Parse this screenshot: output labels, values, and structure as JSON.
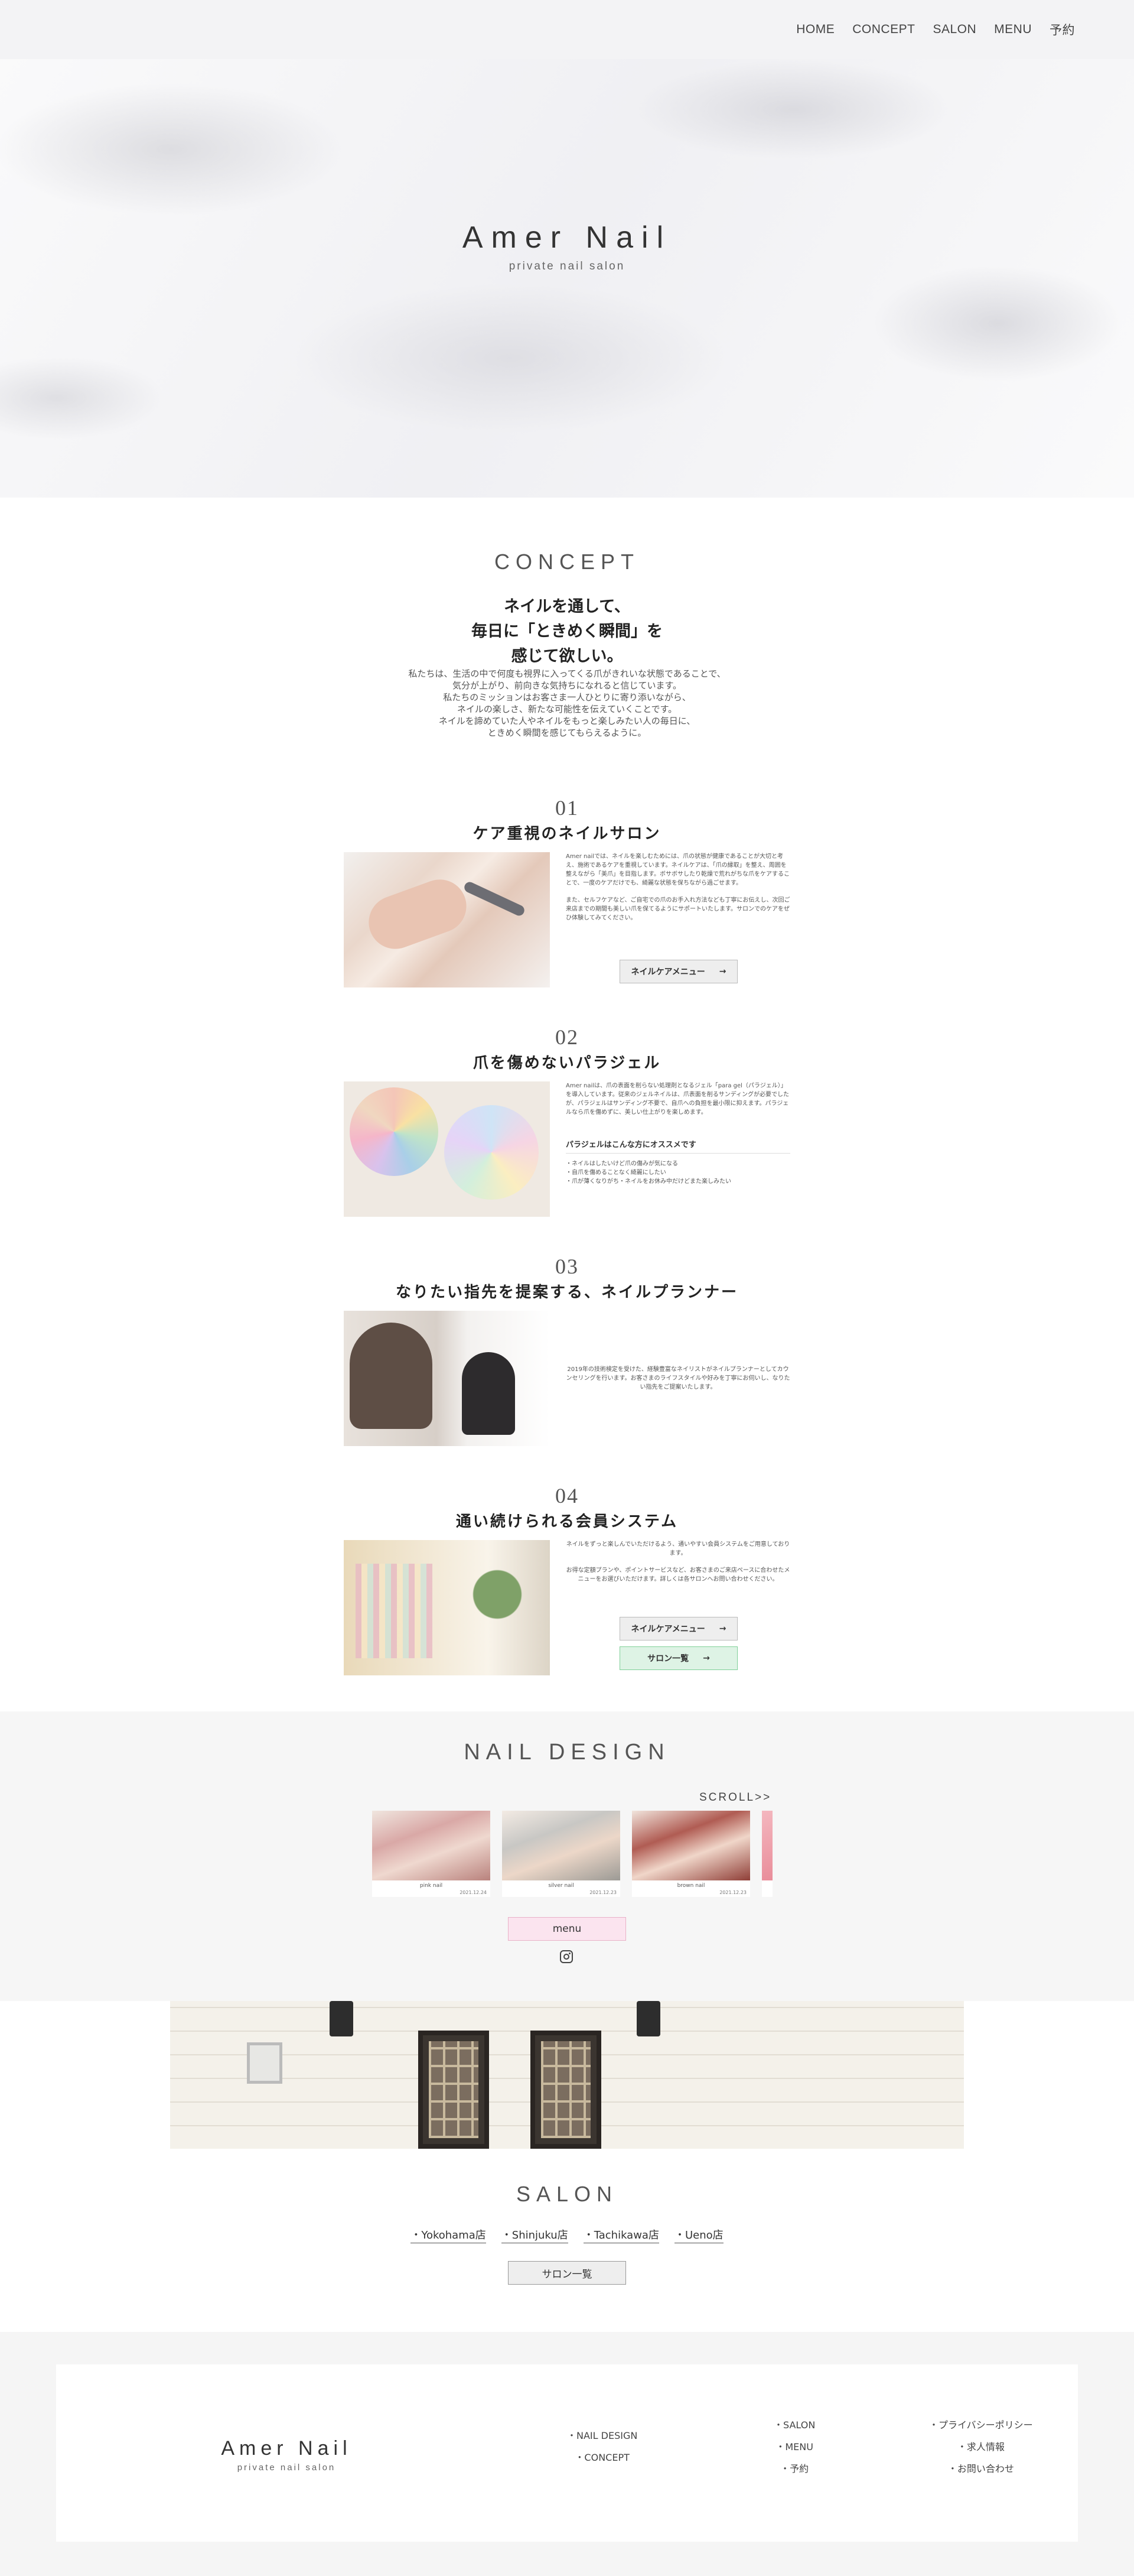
{
  "header": {
    "nav": [
      "HOME",
      "CONCEPT",
      "SALON",
      "MENU",
      "予約"
    ]
  },
  "brand": {
    "name": "Amer Nail",
    "tagline": "private nail salon"
  },
  "concept": {
    "title": "CONCEPT",
    "lead": [
      "ネイルを通して、",
      "毎日に「ときめく瞬間」を",
      "感じて欲しい。"
    ],
    "body": [
      "私たちは、生活の中で何度も視界に入ってくる爪がきれいな状態であることで、",
      "気分が上がり、前向きな気持ちになれると信じています。",
      "私たちのミッションはお客さま一人ひとりに寄り添いながら、",
      "ネイルの楽しさ、新たな可能性を伝えていくことです。",
      "ネイルを諦めていた人やネイルをもっと楽しみたい人の毎日に、",
      "ときめく瞬間を感じてもらえるように。"
    ]
  },
  "features": [
    {
      "num": "01",
      "heading": "ケア重視のネイルサロン",
      "icon": "nail-care-photo",
      "paragraphs": [
        "Amer nailでは、ネイルを楽しむためには、爪の状態が健康であることが大切と考え、施術であるケアを重視しています。ネイルケアは、「爪の縁取」を整え、周囲を整えながら「美爪」を目指します。ボサボサしたり乾燥で荒れがちな爪をケアすることで、一度のケアだけでも、綺麗な状態を保ちながら過ごせます。",
        "また、セルフケアなど、ご自宅での爪のお手入れ方法なども丁寧にお伝えし、次回ご来店までの期間も美しい爪を保てるようにサポートいたします。サロンでのケアをぜひ体験してみてください。"
      ],
      "button": "ネイルケアメニュー"
    },
    {
      "num": "02",
      "heading": "爪を傷めないパラジェル",
      "icon": "para-gel-photo",
      "paragraphs": [
        "Amer nailは、爪の表面を削らない処理剤となるジェル「para gel（パラジェル）」を導入しています。従来のジェルネイルは、爪表面を削るサンディングが必要でしたが、パラジェルはサンディング不要で、自爪への負担を最小限に抑えます。パラジェルなら爪を傷めずに、美しい仕上がりを楽しめます。"
      ],
      "sub_heading": "パラジェルはこんな方にオススメです",
      "bullets": [
        "・ネイルはしたいけど爪の傷みが気になる",
        "・自爪を傷めることなく綺麗にしたい",
        "・爪が薄くなりがち・ネイルをお休み中だけどまた楽しみたい"
      ]
    },
    {
      "num": "03",
      "heading": "なりたい指先を提案する、ネイルプランナー",
      "icon": "nail-planner-photo",
      "paragraphs": [
        "2019年の技術検定を受けた、経験豊富なネイリストがネイルプランナーとしてカウンセリングを行います。お客さまのライフスタイルや好みを丁寧にお伺いし、なりたい指先をご提案いたします。"
      ]
    },
    {
      "num": "04",
      "heading": "通い続けられる会員システム",
      "icon": "membership-photo",
      "paragraphs": [
        "ネイルをずっと楽しんでいただけるよう、通いやすい会員システムをご用意しております。",
        "お得な定額プランや、ポイントサービスなど、お客さまのご来店ペースに合わせたメニューをお選びいただけます。詳しくは各サロンへお問い合わせください。"
      ],
      "buttons": [
        "ネイルケアメニュー",
        "サロン一覧"
      ]
    }
  ],
  "nail_design": {
    "title": "NAIL DESIGN",
    "scroll": "SCROLL>>",
    "cards": [
      {
        "name": "pink nail",
        "date": "2021.12.24"
      },
      {
        "name": "silver nail",
        "date": "2021.12.23"
      },
      {
        "name": "brown nail",
        "date": "2021.12.23"
      }
    ],
    "menu_button": "menu"
  },
  "salon": {
    "title": "SALON",
    "links": [
      "・Yokohama店",
      "・Shinjuku店",
      "・Tachikawa店",
      "・Ueno店"
    ],
    "list_button": "サロン一覧"
  },
  "footer": {
    "col1": [
      "・NAIL DESIGN",
      "・CONCEPT"
    ],
    "col2": [
      "・SALON",
      "・MENU",
      "・予約"
    ],
    "col3": [
      "・プライバシーポリシー",
      "・求人情報",
      "・お問い合わせ"
    ]
  },
  "colors": {
    "menu_pink": "#fbe4ef",
    "salon_mint": "#def3e5",
    "gray_bg": "#f6f6f6"
  }
}
